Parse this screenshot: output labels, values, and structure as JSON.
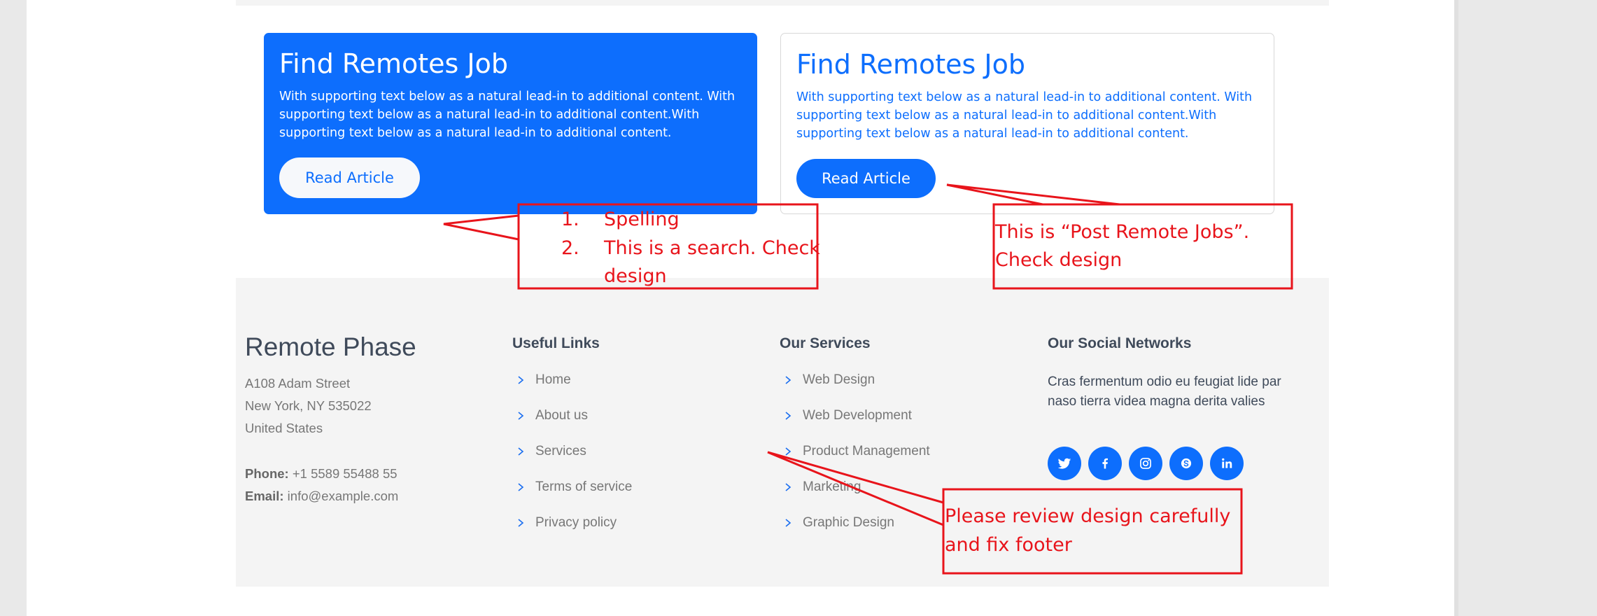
{
  "cards": [
    {
      "title": "Find Remotes Job",
      "text": "With supporting text below as a natural lead-in to additional content. With supporting text below as a natural lead-in to additional content.With supporting text below as a natural lead-in to additional content.",
      "button": "Read Article"
    },
    {
      "title": "Find Remotes Job",
      "text": "With supporting text below as a natural lead-in to additional content. With supporting text below as a natural lead-in to additional content.With supporting text below as a natural lead-in to additional content.",
      "button": "Read Article"
    }
  ],
  "footer": {
    "brand": "Remote Phase",
    "address": [
      "A108 Adam Street",
      "New York, NY 535022",
      "United States"
    ],
    "phone_label": "Phone:",
    "phone": "+1 5589 55488 55",
    "email_label": "Email:",
    "email": "info@example.com",
    "useful_links": {
      "heading": "Useful Links",
      "items": [
        "Home",
        "About us",
        "Services",
        "Terms of service",
        "Privacy policy"
      ]
    },
    "services": {
      "heading": "Our Services",
      "items": [
        "Web Design",
        "Web Development",
        "Product Management",
        "Marketing",
        "Graphic Design"
      ]
    },
    "social": {
      "heading": "Our Social Networks",
      "text": "Cras fermentum odio eu feugiat lide par naso tierra videa magna derita valies",
      "icons": [
        "twitter-icon",
        "facebook-icon",
        "instagram-icon",
        "skype-icon",
        "linkedin-icon"
      ]
    }
  },
  "annotations": {
    "list_numbers": [
      "1.",
      "2."
    ],
    "note1_item1": "Spelling",
    "note1_item2_line1": "This is a search. Check",
    "note1_item2_line2": "design",
    "note2_line1": "This is “Post Remote Jobs”.",
    "note2_line2": "Check design",
    "note3_line1": "Please review design carefully",
    "note3_line2": "and fix footer"
  },
  "colors": {
    "primary": "#0d6efd",
    "annotation": "#e8141b",
    "footer_bg": "#f4f4f4"
  }
}
